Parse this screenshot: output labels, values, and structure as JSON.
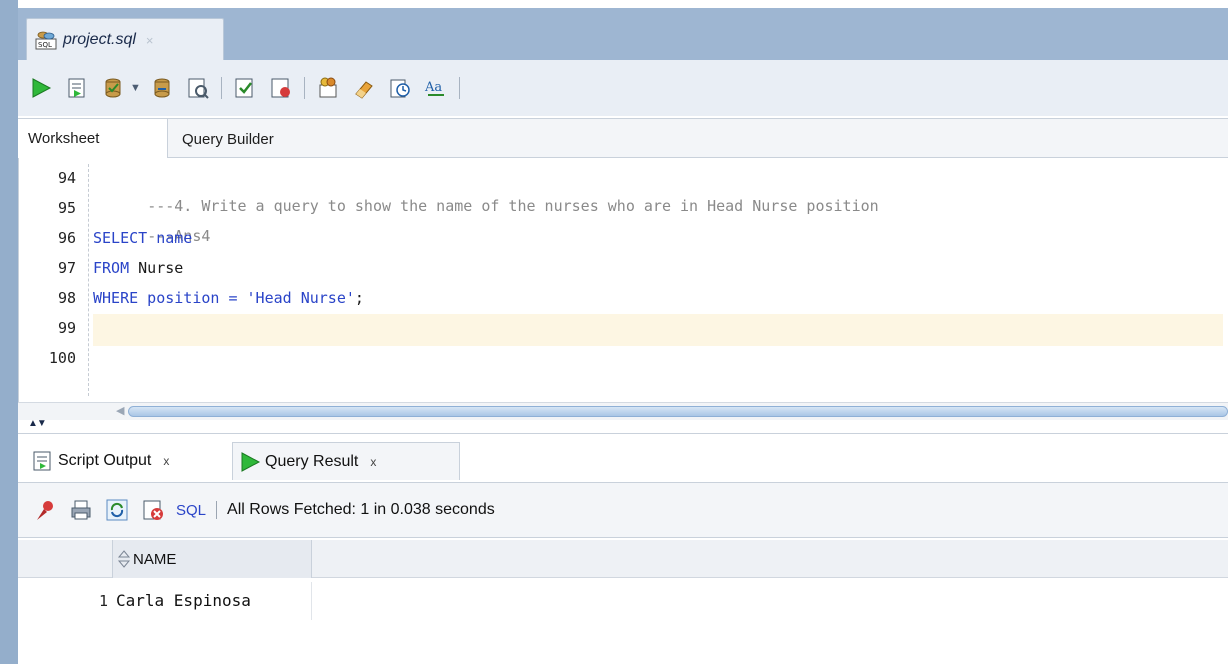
{
  "document_tab": {
    "title": "project.sql",
    "close": "×"
  },
  "toolbar": {
    "buttons": [
      "run-statement-icon",
      "run-script-icon",
      "commit-icon",
      "rollback-icon",
      "autotrace-icon",
      "explain-plan-icon",
      "sql-tuning-icon",
      "clear-icon",
      "history-icon",
      "format-icon"
    ]
  },
  "editor_tabs": {
    "worksheet": "Worksheet",
    "query_builder": "Query Builder"
  },
  "editor": {
    "lines": [
      {
        "no": "94",
        "text": "---4. Write a query to show the name of the nurses who are in Head Nurse position"
      },
      {
        "no": "95",
        "text": "---Ans4"
      },
      {
        "no": "96",
        "kw": "SELECT",
        "rest": " name"
      },
      {
        "no": "97",
        "kw": "FROM",
        "rest": " Nurse"
      },
      {
        "no": "98",
        "kw": "WHERE",
        "rest": " position = ",
        "str": "'Head Nurse'",
        "end": ";"
      },
      {
        "no": "99",
        "text": ""
      },
      {
        "no": "100",
        "text": ""
      }
    ]
  },
  "result_tabs": {
    "script_output": "Script Output",
    "query_result": "Query Result",
    "close": "x"
  },
  "result_toolbar": {
    "sql_label": "SQL",
    "status": "All Rows Fetched: 1 in 0.038 seconds"
  },
  "grid": {
    "columns": [
      "NAME"
    ],
    "rows": [
      {
        "num": "1",
        "NAME": "Carla Espinosa"
      }
    ]
  },
  "colors": {
    "frame": "#94aecb",
    "keyword": "#2a44c8",
    "comment": "#8a8a8a",
    "current_line": "#fdf6e3"
  }
}
